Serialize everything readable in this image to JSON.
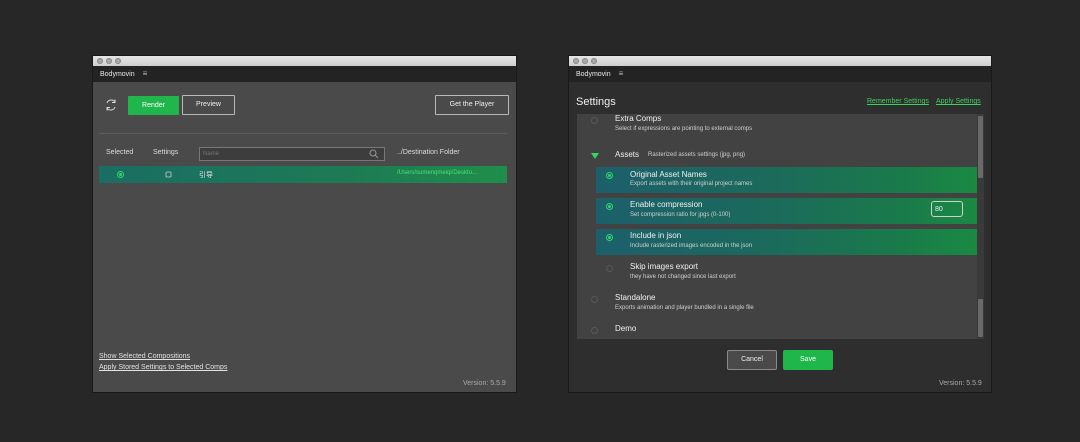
{
  "left": {
    "tab_label": "Bodymovin",
    "render_label": "Render",
    "preview_label": "Preview",
    "get_player_label": "Get the Player",
    "columns": {
      "selected": "Selected",
      "settings": "Settings",
      "name_placeholder": "Name",
      "destination": "../Destination Folder"
    },
    "row": {
      "name": "引导",
      "destination": "/Users/sumenqmeiqi/Deskto..."
    },
    "links": {
      "show_selected": "Show Selected Compositions",
      "apply_stored": "Apply Stored Settings to Selected Comps"
    },
    "version": "Version: 5.5.9"
  },
  "right": {
    "tab_label": "Bodymovin",
    "title": "Settings",
    "remember_label": "Remember Settings",
    "apply_label": "Apply Settings",
    "options": {
      "extra_comps": {
        "title": "Extra Comps",
        "desc": "Select if expressions are pointing to external comps"
      },
      "assets": {
        "title": "Assets",
        "desc": "Rasterized assets settings (jpg, png)"
      },
      "original_names": {
        "title": "Original Asset Names",
        "desc": "Export assets with their original project names"
      },
      "compression": {
        "title": "Enable compression",
        "desc": "Set compression ratio for jpgs (0-100)",
        "value": "80"
      },
      "include_json": {
        "title": "Include in json",
        "desc": "Include rasterized images encoded in the json"
      },
      "skip_images": {
        "title": "Skip images export",
        "desc": "they have not changed since last export"
      },
      "standalone": {
        "title": "Standalone",
        "desc": "Exports animation and player bundled in a single file"
      },
      "demo": {
        "title": "Demo",
        "desc": ""
      }
    },
    "cancel_label": "Cancel",
    "save_label": "Save",
    "version": "Version: 5.5.9"
  },
  "colors": {
    "accent_green": "#1fb64b",
    "link_green": "#3fcf5b",
    "row_teal": "#1c5f6b"
  }
}
